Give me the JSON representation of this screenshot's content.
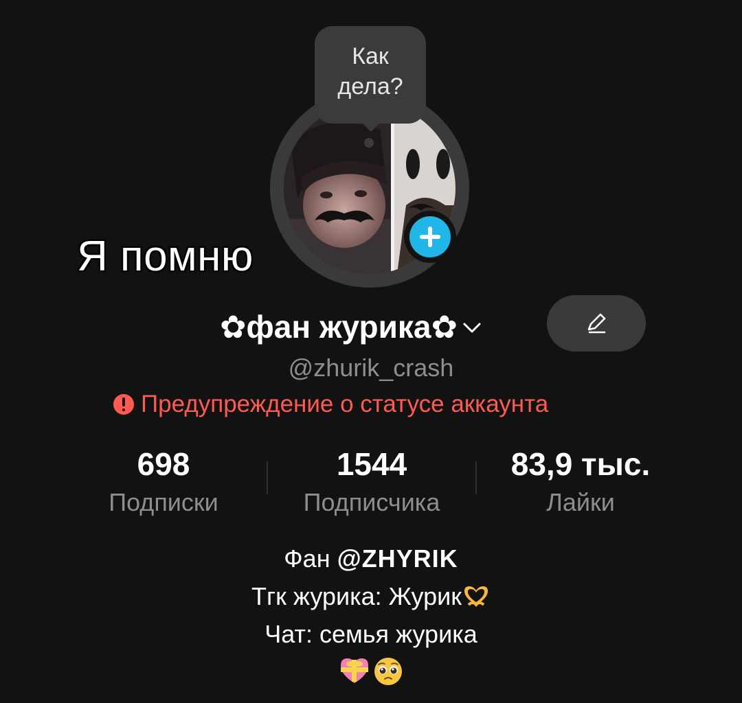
{
  "status_bubble": {
    "line1": "Как",
    "line2": "дела?"
  },
  "sticker_text": "Я помню",
  "profile": {
    "display_name": "✿фан журика✿",
    "username": "@zhurik_crash",
    "warning": "Предупреждение о статусе аккаунта"
  },
  "stats": {
    "following": {
      "value": "698",
      "label": "Подписки"
    },
    "followers": {
      "value": "1544",
      "label": "Подписчика"
    },
    "likes": {
      "value": "83,9 тыс.",
      "label": "Лайки"
    }
  },
  "bio": {
    "line1_prefix": "Фан ",
    "line1_mention": "@ZHYRIK",
    "line2": "Тгк журика: Журик",
    "line3": "Чат: семья журика"
  },
  "icons": {
    "chevron": "chevron-down-icon",
    "edit": "pencil-icon",
    "add": "plus-icon",
    "warning": "exclamation-icon",
    "heart_hands": "heart-hands-emoji",
    "gift_heart": "heart-with-ribbon-emoji",
    "pleading": "pleading-face-emoji"
  },
  "colors": {
    "background": "#121212",
    "accent_blue": "#20b7e8",
    "warning_red": "#fe5a52",
    "muted_text": "#8e8e8e"
  }
}
